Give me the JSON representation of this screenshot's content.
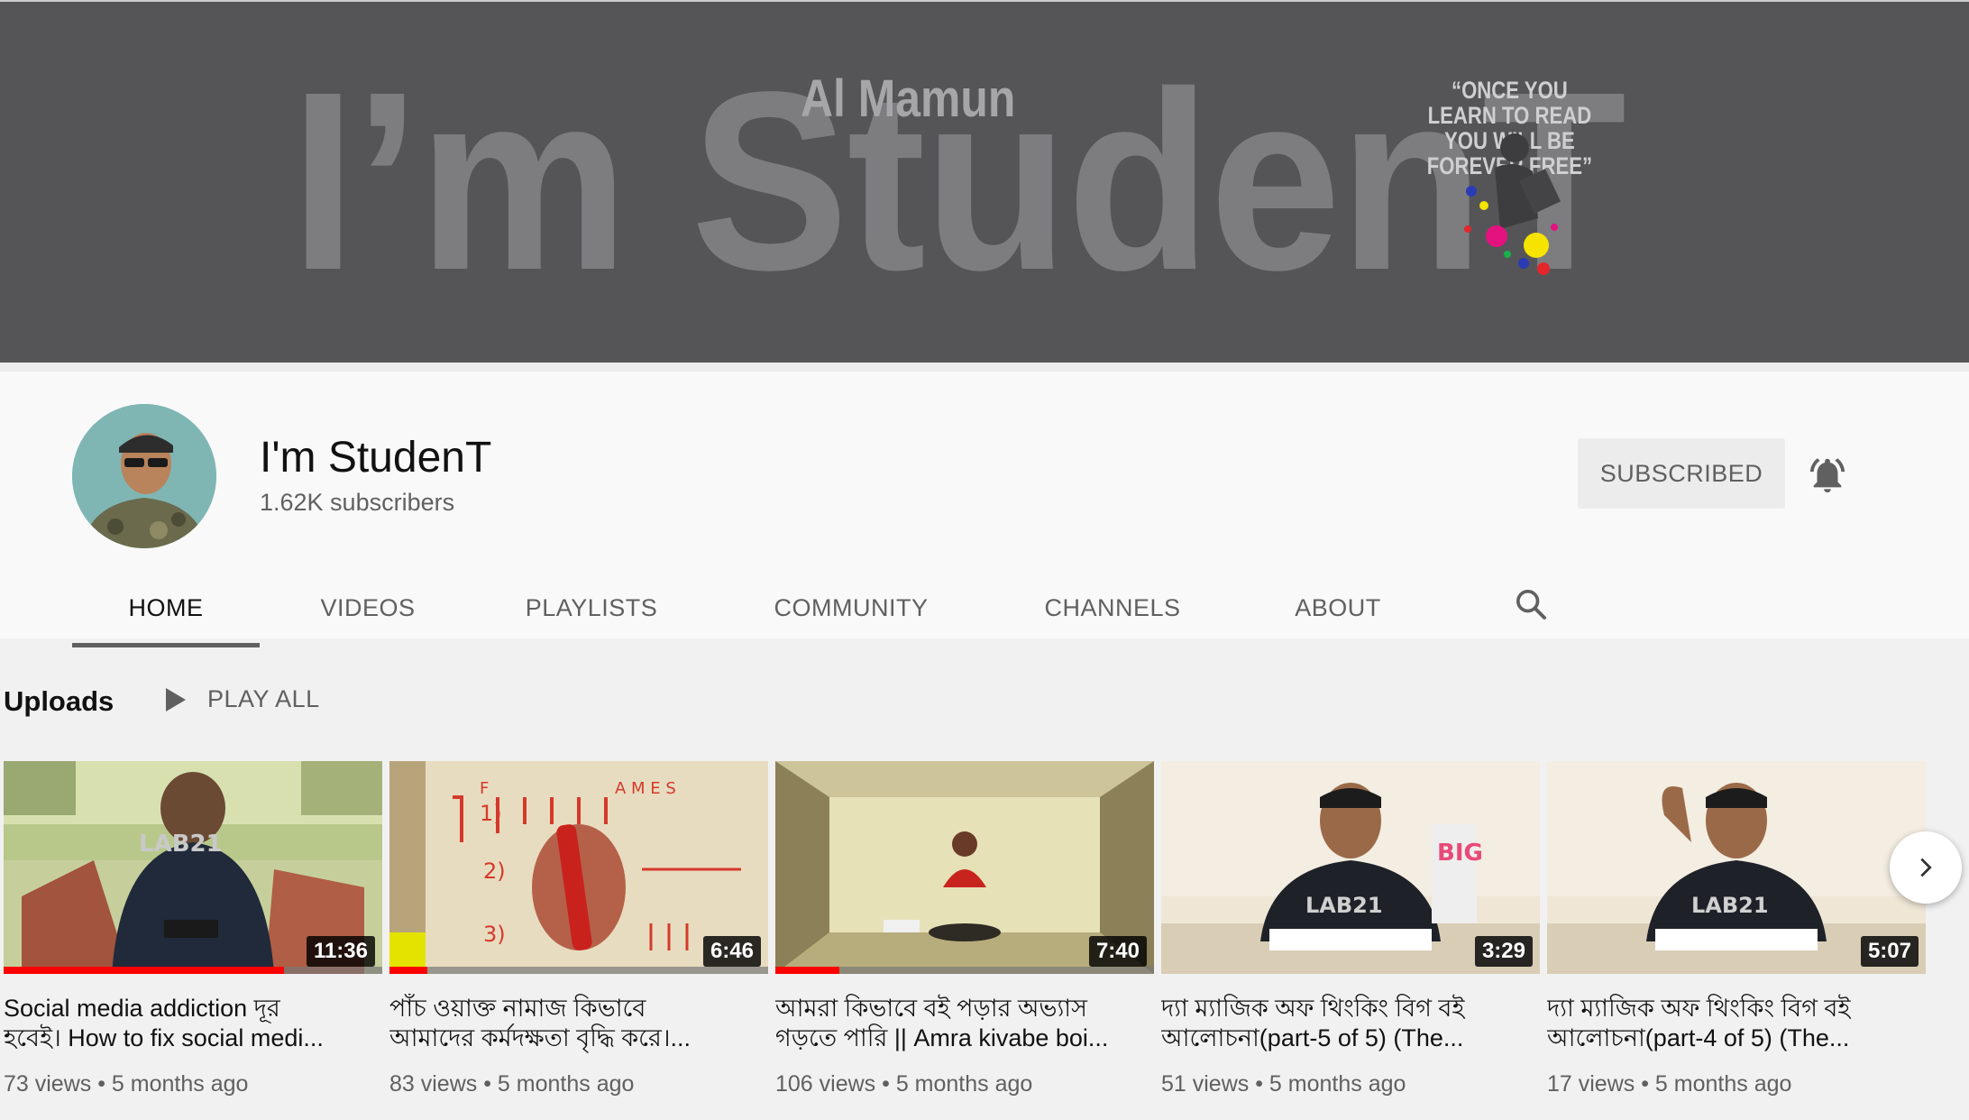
{
  "banner": {
    "main_text": "I’m StudenT",
    "sub_text": "Al Mamun",
    "quote": "“ONCE YOU LEARN TO READ YOU WILL BE FOREVER FREE”"
  },
  "channel": {
    "name": "I'm StudenT",
    "subscribers": "1.62K subscribers",
    "subscribe_label": "SUBSCRIBED"
  },
  "tabs": [
    {
      "label": "HOME",
      "active": true
    },
    {
      "label": "VIDEOS"
    },
    {
      "label": "PLAYLISTS"
    },
    {
      "label": "COMMUNITY"
    },
    {
      "label": "CHANNELS"
    },
    {
      "label": "ABOUT"
    }
  ],
  "uploads": {
    "title": "Uploads",
    "play_all": "PLAY ALL",
    "videos": [
      {
        "line1": "Social media addiction দূর",
        "line2": "হবেই। How to fix social medi...",
        "views": "73 views",
        "age": "5 months ago",
        "duration": "11:36",
        "watched": 0.74
      },
      {
        "line1": "পাঁচ ওয়াক্ত নামাজ কিভাবে",
        "line2": "আমাদের কর্মদক্ষতা বৃদ্ধি করে।...",
        "views": "83 views",
        "age": "5 months ago",
        "duration": "6:46",
        "watched": 0.1
      },
      {
        "line1": "আমরা কিভাবে বই পড়ার অভ্যাস",
        "line2": "গড়তে পারি || Amra kivabe boi...",
        "views": "106 views",
        "age": "5 months ago",
        "duration": "7:40",
        "watched": 0.17
      },
      {
        "line1": "দ্যা ম্যাজিক অফ থিংকিং বিগ বই",
        "line2": "আলোচনা(part-5 of 5) (The...",
        "views": "51 views",
        "age": "5 months ago",
        "duration": "3:29",
        "watched": 0
      },
      {
        "line1": "দ্যা ম্যাজিক অফ থিংকিং বিগ বই",
        "line2": "আলোচনা(part-4 of 5) (The...",
        "views": "17 views",
        "age": "5 months ago",
        "duration": "5:07",
        "watched": 0
      }
    ]
  },
  "colors": {
    "accent": "#ff0000",
    "banner_bg": "#555557"
  },
  "icons": [
    "bell-icon",
    "search-icon",
    "play-icon",
    "chevron-right-icon"
  ]
}
